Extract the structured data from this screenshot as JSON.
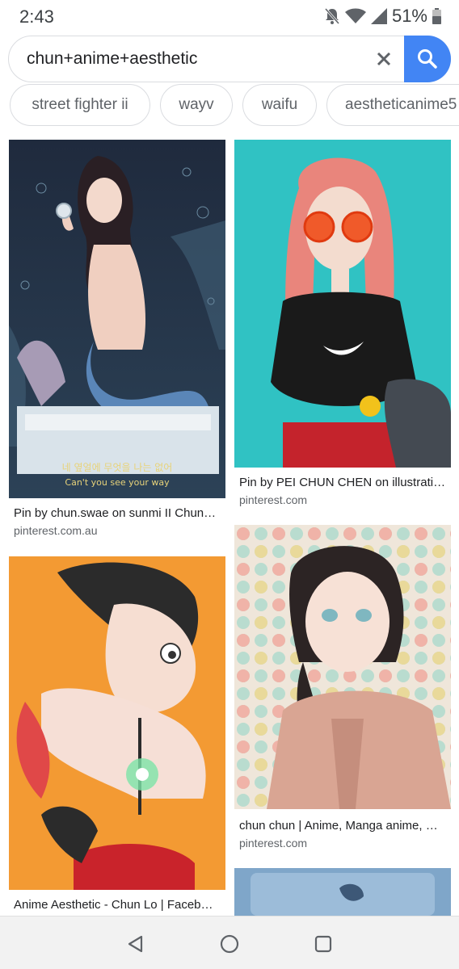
{
  "status_bar": {
    "time": "2:43",
    "battery": "51%",
    "icons": [
      "notifications-off-icon",
      "wifi-icon",
      "cell-signal-icon",
      "battery-icon"
    ]
  },
  "search": {
    "query": "chun+anime+aesthetic",
    "clear_icon": "close-icon",
    "search_icon": "search-icon",
    "accent_color": "#4285f4"
  },
  "chips": [
    {
      "label": "street fighter ii"
    },
    {
      "label": "wayv"
    },
    {
      "label": "waifu"
    },
    {
      "label": "aestheticanime5"
    }
  ],
  "results": [
    {
      "title": "Pin by chun.swae on sunmi II Chun…",
      "source": "pinterest.com.au",
      "image": "mermaid-girl-illustration",
      "image_caption_line1": "네 옆얼에 무엇을 나는 없어",
      "image_caption_line2": "Can't you see your way"
    },
    {
      "title": "Pin by PEI CHUN CHEN on illustrati…",
      "source": "pinterest.com",
      "image": "girl-orange-sunglasses-illustration"
    },
    {
      "title": "Anime Aesthetic - Chun Lo | Faceb…",
      "source": "",
      "image": "astro-boy-illustration"
    },
    {
      "title": "chun chun | Anime, Manga anime, …",
      "source": "pinterest.com",
      "image": "braided-girl-polka-dot-illustration"
    },
    {
      "title": "",
      "source": "",
      "image": "partial-blue-illustration"
    }
  ],
  "nav": {
    "back_icon": "back-triangle-icon",
    "home_icon": "home-circle-icon",
    "recents_icon": "recents-square-icon"
  }
}
